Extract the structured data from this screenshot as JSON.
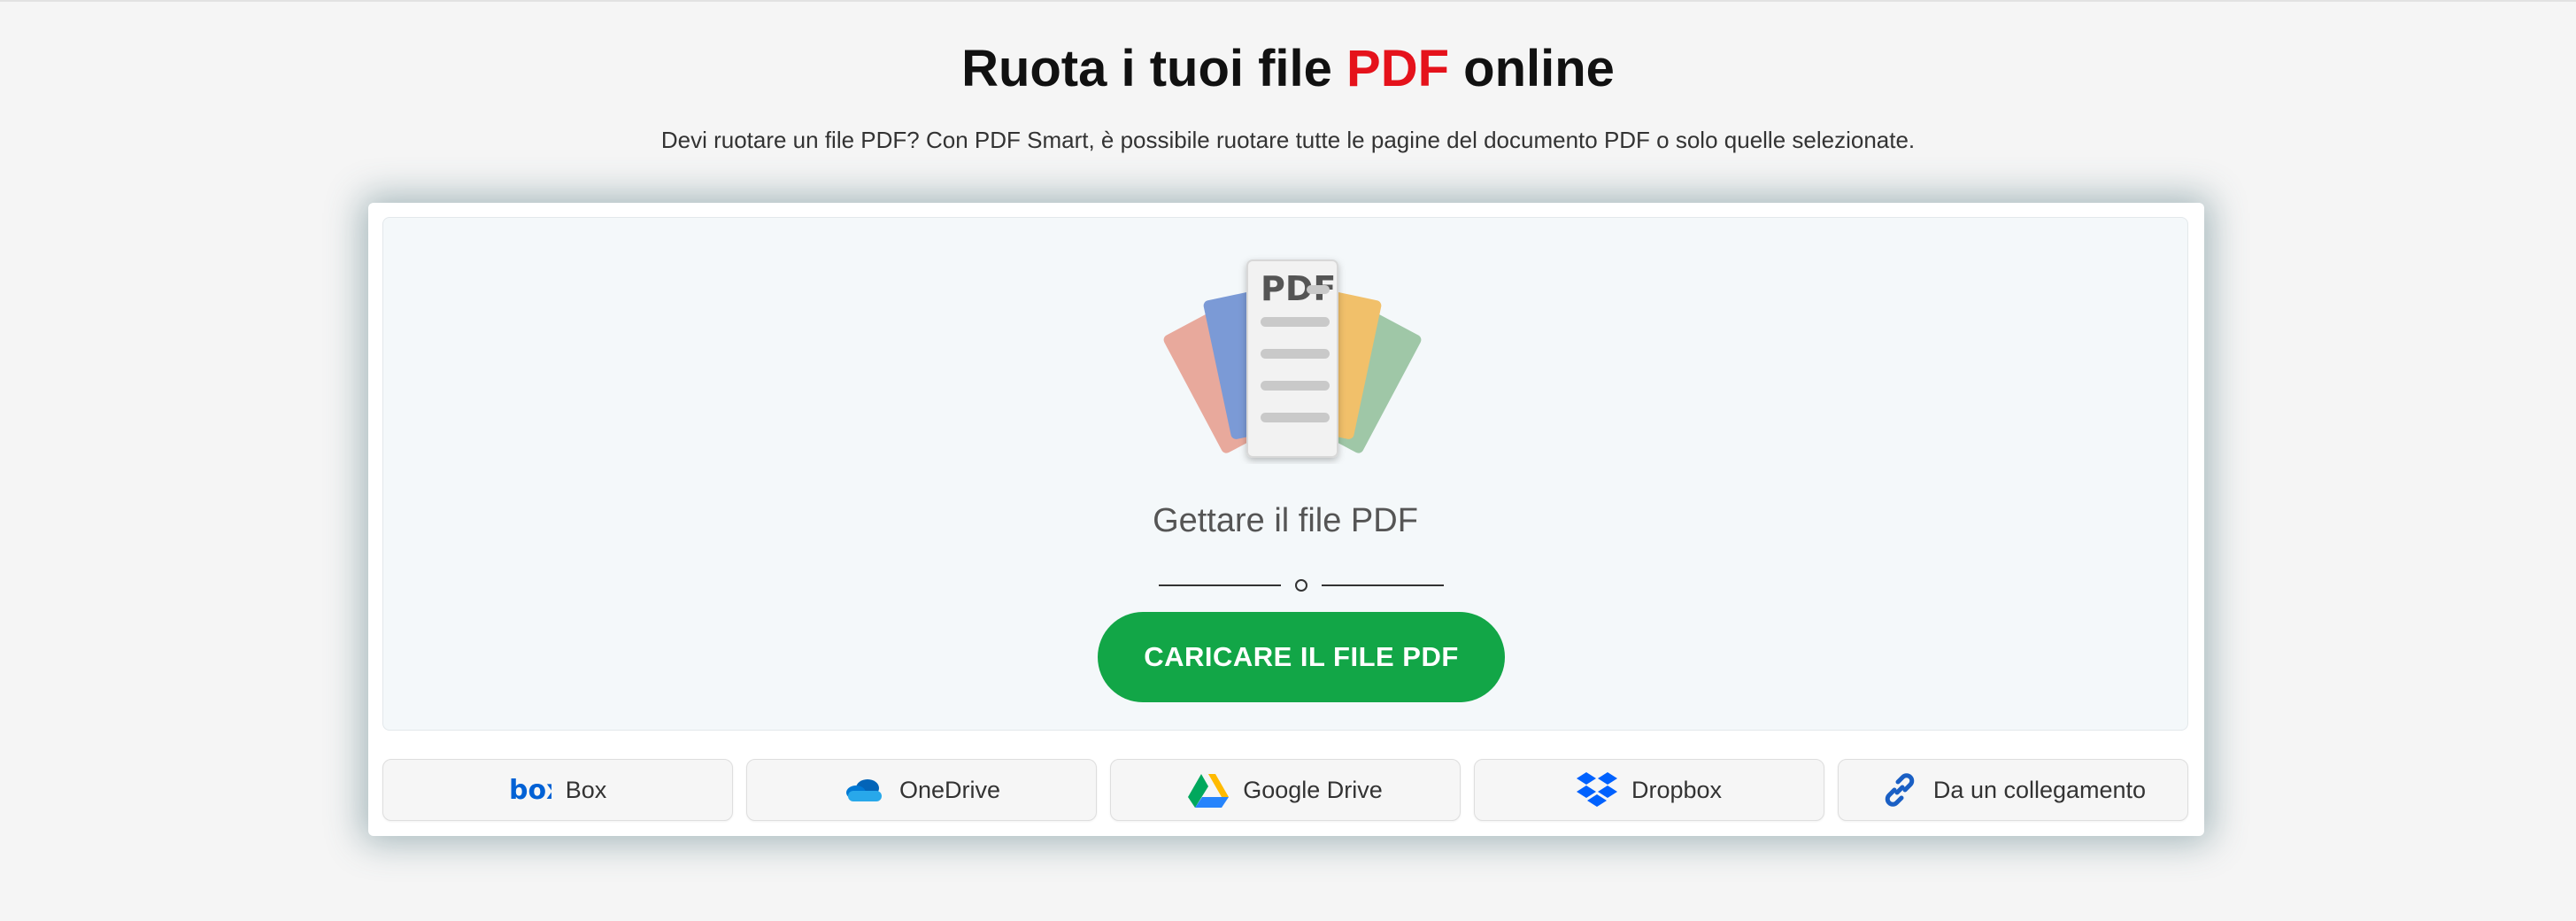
{
  "header": {
    "title_before": "Ruota i tuoi file ",
    "title_accent": "PDF",
    "title_after": " online",
    "subtitle": "Devi ruotare un file PDF? Con PDF Smart, è possibile ruotare tutte le pagine del documento PDF o solo quelle selezionate."
  },
  "dropzone": {
    "illustration_label": "PDF",
    "drop_text": "Gettare il file PDF",
    "divider_text": "o",
    "upload_button": "CARICARE IL FILE PDF"
  },
  "sources": [
    {
      "label": "Box",
      "icon": "box-icon"
    },
    {
      "label": "OneDrive",
      "icon": "onedrive-icon"
    },
    {
      "label": "Google Drive",
      "icon": "google-drive-icon"
    },
    {
      "label": "Dropbox",
      "icon": "dropbox-icon"
    },
    {
      "label": "Da un collegamento",
      "icon": "link-icon"
    }
  ],
  "colors": {
    "accent_red": "#e5121b",
    "upload_green": "#12a647",
    "background": "#f5f5f5"
  }
}
